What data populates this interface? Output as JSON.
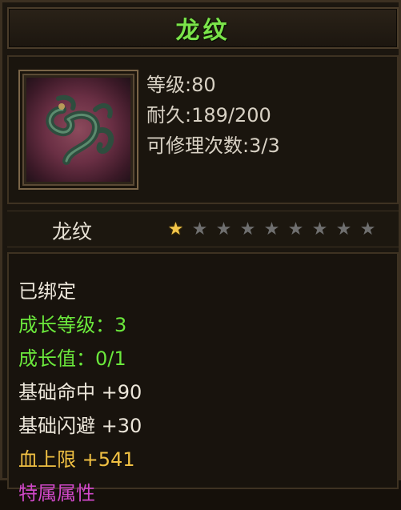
{
  "title": "龙纹",
  "item": {
    "icon": "dragon-emblem-icon",
    "stats": [
      "等级:80",
      "耐久:189/200",
      "可修理次数:3/3"
    ]
  },
  "name_row": {
    "name": "龙纹",
    "stars_filled": 1,
    "stars_total": 9
  },
  "details": [
    {
      "text": "已绑定",
      "color": "white"
    },
    {
      "text": "成长等级：3",
      "color": "green"
    },
    {
      "text": "成长值：0/1",
      "color": "green"
    },
    {
      "text": "基础命中  +90",
      "color": "white"
    },
    {
      "text": "基础闪避  +30",
      "color": "white"
    },
    {
      "text": "血上限  +541",
      "color": "yellow"
    },
    {
      "text": "特属属性",
      "color": "magenta"
    }
  ],
  "colors": {
    "title": "#7be34a",
    "green": "#6be83c",
    "yellow": "#f0c043",
    "magenta": "#d048c8"
  }
}
